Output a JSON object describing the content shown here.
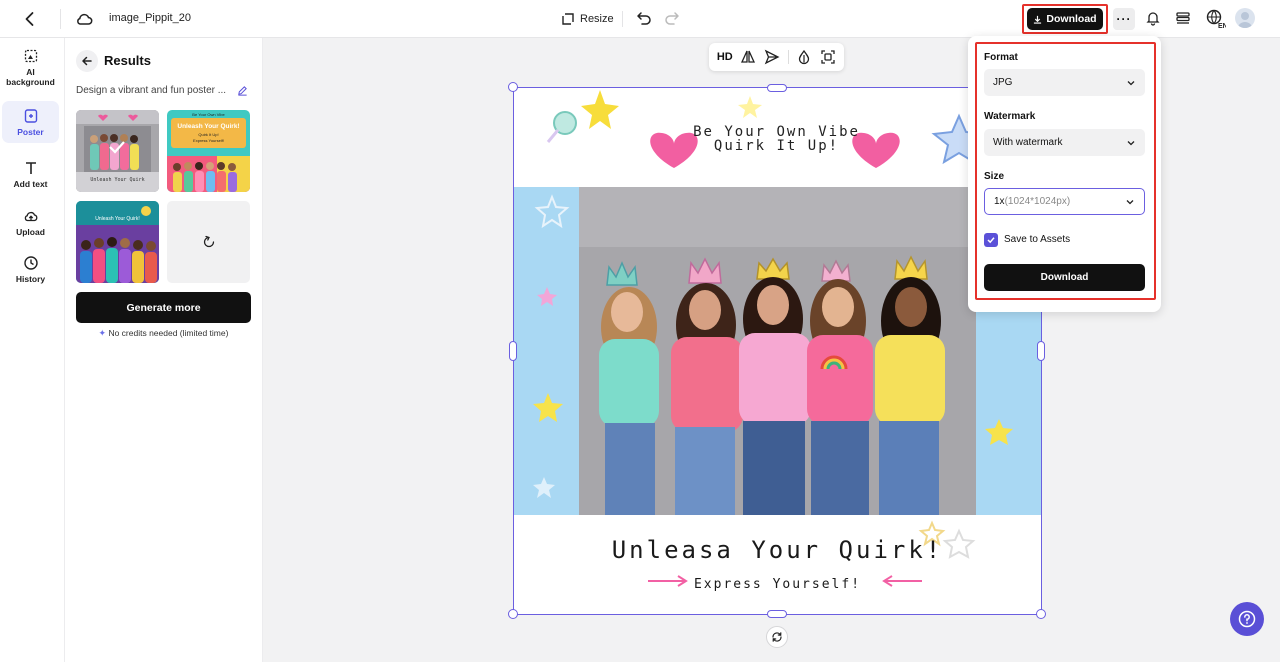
{
  "topbar": {
    "project_name": "image_Pippit_20",
    "resize_label": "Resize",
    "download_label": "Download",
    "more_label": "···",
    "language": "EN"
  },
  "rail": {
    "items": [
      {
        "label": "AI background",
        "icon": "ai-background-icon"
      },
      {
        "label": "Poster",
        "icon": "poster-icon",
        "active": true
      },
      {
        "label": "Add text",
        "icon": "text-icon"
      },
      {
        "label": "Upload",
        "icon": "upload-icon"
      },
      {
        "label": "History",
        "icon": "history-icon"
      }
    ]
  },
  "results": {
    "title": "Results",
    "prompt": "Design a vibrant and fun poster ...",
    "thumb_texts": {
      "t1": "Unleash Your Quirk",
      "t2_top": "Be Your Own Vibe",
      "t2_title": "Unleash Your Quirk!",
      "t2_sub1": "Quirk It Up!",
      "t2_sub2": "Express Yourself!",
      "t3": "Unleash Your Quirk!"
    },
    "generate_more": "Generate more",
    "credits_note": "No credits needed (limited time)"
  },
  "canvas_toolbar": {
    "hd_label": "HD"
  },
  "poster": {
    "tagline_line1": "Be Your Own Vibe",
    "tagline_line2": "Quirk It Up!",
    "headline": "Unleasa Your Quirk!",
    "subline": "Express Yourself!"
  },
  "download_panel": {
    "format_label": "Format",
    "format_value": "JPG",
    "watermark_label": "Watermark",
    "watermark_value": "With watermark",
    "size_label": "Size",
    "size_value": "1x",
    "size_detail": "(1024*1024px)",
    "save_to_assets_label": "Save to Assets",
    "save_to_assets_checked": true,
    "download_button": "Download"
  },
  "colors": {
    "accent": "#5b51d8",
    "highlight": "#e5312b",
    "primary_button": "#111111"
  }
}
